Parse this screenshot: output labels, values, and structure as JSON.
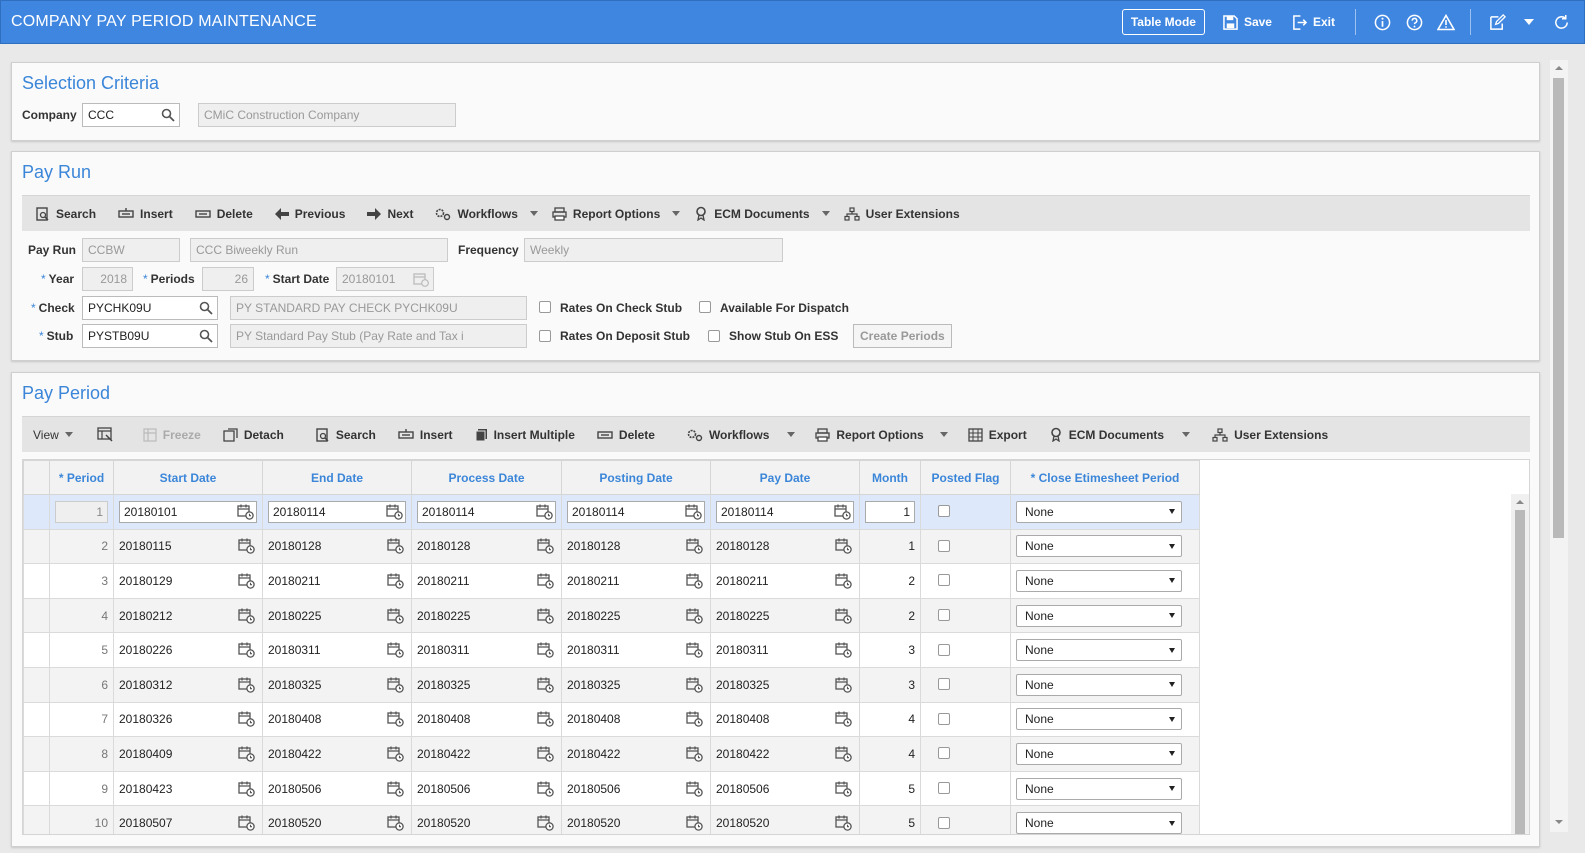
{
  "app": {
    "title": "COMPANY PAY PERIOD MAINTENANCE",
    "table_mode_label": "Table Mode",
    "save_label": "Save",
    "exit_label": "Exit"
  },
  "selection": {
    "title": "Selection Criteria",
    "company_label": "Company",
    "company_value": "CCC",
    "company_name": "CMiC Construction Company"
  },
  "payrun": {
    "title": "Pay Run",
    "toolbar": {
      "search": "Search",
      "insert": "Insert",
      "delete": "Delete",
      "previous": "Previous",
      "next": "Next",
      "workflows": "Workflows",
      "report_options": "Report Options",
      "ecm_documents": "ECM Documents",
      "user_extensions": "User Extensions"
    },
    "payrun_label": "Pay Run",
    "payrun_code": "CCBW",
    "payrun_name": "CCC Biweekly Run",
    "frequency_label": "Frequency",
    "frequency_value": "Weekly",
    "year_label": "Year",
    "year_value": "2018",
    "periods_label": "Periods",
    "periods_value": "26",
    "start_date_label": "Start Date",
    "start_date_value": "20180101",
    "check_label": "Check",
    "check_value": "PYCHK09U",
    "check_desc": "PY STANDARD PAY CHECK PYCHK09U",
    "stub_label": "Stub",
    "stub_value": "PYSTB09U",
    "stub_desc": "PY Standard Pay Stub (Pay Rate and Tax i",
    "rates_on_check_stub": "Rates On Check Stub",
    "available_for_dispatch": "Available For Dispatch",
    "rates_on_deposit_stub": "Rates On Deposit Stub",
    "show_stub_on_ess": "Show Stub On ESS",
    "create_periods": "Create Periods",
    "required_mark": "*"
  },
  "payperiod": {
    "title": "Pay Period",
    "toolbar": {
      "view": "View",
      "freeze": "Freeze",
      "detach": "Detach",
      "search": "Search",
      "insert": "Insert",
      "insert_multiple": "Insert Multiple",
      "delete": "Delete",
      "workflows": "Workflows",
      "report_options": "Report Options",
      "export": "Export",
      "ecm_documents": "ECM Documents",
      "user_extensions": "User Extensions"
    },
    "columns": {
      "period": "* Period",
      "start_date": "Start Date",
      "end_date": "End Date",
      "process_date": "Process Date",
      "posting_date": "Posting Date",
      "pay_date": "Pay Date",
      "month": "Month",
      "posted_flag": "Posted Flag",
      "close_etimesheet": "* Close Etimesheet Period"
    },
    "rows": [
      {
        "period": "1",
        "start": "20180101",
        "end": "20180114",
        "process": "20180114",
        "posting": "20180114",
        "pay": "20180114",
        "month": "1",
        "close": "None"
      },
      {
        "period": "2",
        "start": "20180115",
        "end": "20180128",
        "process": "20180128",
        "posting": "20180128",
        "pay": "20180128",
        "month": "1",
        "close": "None"
      },
      {
        "period": "3",
        "start": "20180129",
        "end": "20180211",
        "process": "20180211",
        "posting": "20180211",
        "pay": "20180211",
        "month": "2",
        "close": "None"
      },
      {
        "period": "4",
        "start": "20180212",
        "end": "20180225",
        "process": "20180225",
        "posting": "20180225",
        "pay": "20180225",
        "month": "2",
        "close": "None"
      },
      {
        "period": "5",
        "start": "20180226",
        "end": "20180311",
        "process": "20180311",
        "posting": "20180311",
        "pay": "20180311",
        "month": "3",
        "close": "None"
      },
      {
        "period": "6",
        "start": "20180312",
        "end": "20180325",
        "process": "20180325",
        "posting": "20180325",
        "pay": "20180325",
        "month": "3",
        "close": "None"
      },
      {
        "period": "7",
        "start": "20180326",
        "end": "20180408",
        "process": "20180408",
        "posting": "20180408",
        "pay": "20180408",
        "month": "4",
        "close": "None"
      },
      {
        "period": "8",
        "start": "20180409",
        "end": "20180422",
        "process": "20180422",
        "posting": "20180422",
        "pay": "20180422",
        "month": "4",
        "close": "None"
      },
      {
        "period": "9",
        "start": "20180423",
        "end": "20180506",
        "process": "20180506",
        "posting": "20180506",
        "pay": "20180506",
        "month": "5",
        "close": "None"
      },
      {
        "period": "10",
        "start": "20180507",
        "end": "20180520",
        "process": "20180520",
        "posting": "20180520",
        "pay": "20180520",
        "month": "5",
        "close": "None"
      }
    ]
  },
  "colors": {
    "header_bg": "#3f86e0",
    "accent": "#3b86d9",
    "selected_row": "#dde9fb"
  }
}
